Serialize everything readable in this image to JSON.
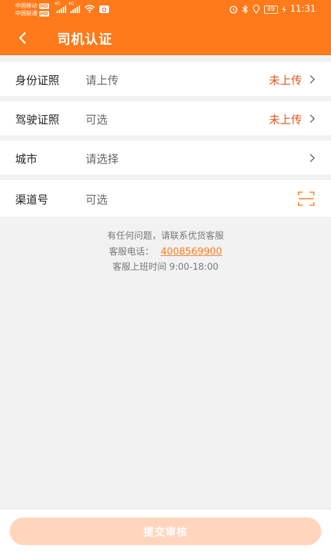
{
  "status_bar": {
    "carrier1": "中国移动",
    "carrier2": "中国联通",
    "hd": "HD",
    "net1": "4G",
    "net2": "4G",
    "battery": "49",
    "time": "11:31"
  },
  "header": {
    "title": "司机认证"
  },
  "form": {
    "rows": [
      {
        "label": "身份证照",
        "value": "请上传",
        "status": "未上传"
      },
      {
        "label": "驾驶证照",
        "value": "可选",
        "status": "未上传"
      },
      {
        "label": "城市",
        "value": "请选择",
        "status": ""
      },
      {
        "label": "渠道号",
        "value": "可选",
        "status": ""
      }
    ]
  },
  "help": {
    "line1": "有任何问题，请联系优货客服",
    "phone_label": "客服电话：",
    "phone": "4008569900",
    "hours": "客服上班时间 9:00-18:00"
  },
  "footer": {
    "submit_label": "提交审核"
  },
  "colors": {
    "accent": "#ff7a1a",
    "status_red": "#e0581a",
    "submit_disabled": "#ffd6bd"
  }
}
